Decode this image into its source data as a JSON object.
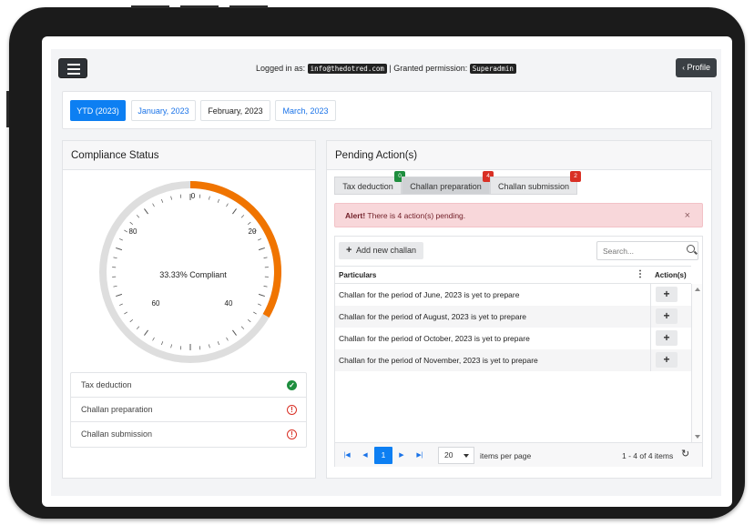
{
  "header": {
    "logged_in_label": "Logged in as:",
    "email": "info@thedotred.com",
    "permission_label": "| Granted permission:",
    "permission": "Superadmin",
    "profile_label": "Profile"
  },
  "periods": [
    {
      "label": "YTD (2023)",
      "active": true
    },
    {
      "label": "January, 2023"
    },
    {
      "label": "February, 2023"
    },
    {
      "label": "March, 2023"
    }
  ],
  "compliance": {
    "title": "Compliance Status",
    "gauge": {
      "value": 33.33,
      "min": 0,
      "max": 100,
      "center_text": "33.33% Compliant",
      "ticks": [
        "0",
        "20",
        "40",
        "60",
        "80"
      ],
      "arc_color": "#f07400",
      "track_color": "#dedede"
    },
    "items": [
      {
        "label": "Tax deduction",
        "status": "complete"
      },
      {
        "label": "Challan preparation",
        "status": "pending"
      },
      {
        "label": "Challan submission",
        "status": "pending"
      }
    ]
  },
  "pending": {
    "title": "Pending Action(s)",
    "tabs": [
      {
        "label": "Tax deduction",
        "count": "0",
        "badge_color": "#1e8e3e"
      },
      {
        "label": "Challan preparation",
        "count": "4",
        "badge_color": "#d93025"
      },
      {
        "label": "Challan submission",
        "count": "2",
        "badge_color": "#d93025"
      }
    ],
    "alert": {
      "strong": "Alert!",
      "text": " There is 4 action(s) pending.",
      "close": "×"
    },
    "grid": {
      "add_label": "Add new challan",
      "search_placeholder": "Search...",
      "columns": [
        "Particulars",
        "Action(s)"
      ],
      "rows": [
        "Challan for the period of June, 2023 is yet to prepare",
        "Challan for the period of August, 2023 is yet to prepare",
        "Challan for the period of October, 2023 is yet to prepare",
        "Challan for the period of November, 2023 is yet to prepare"
      ],
      "action_symbol": "+",
      "pager": {
        "current_page": "1",
        "page_size": "20",
        "items_per_page_label": "items per page",
        "range": "1 - 4 of 4 items"
      }
    }
  }
}
